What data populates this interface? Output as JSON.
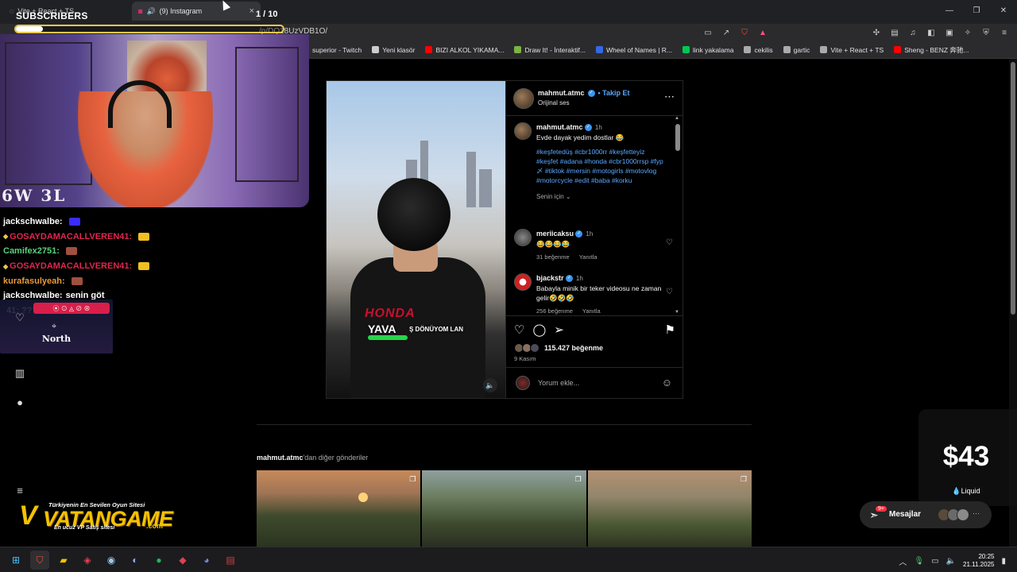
{
  "browser": {
    "inactive_tab_title": "Vite + React + TS",
    "active_tab_title": "(9) Instagram",
    "active_tab_audio": "🔊",
    "url": "/p/DQ18UzVDB1O/",
    "bookmarks": [
      {
        "label": "superior - Twitch",
        "color": "#9146ff"
      },
      {
        "label": "Yeni klasör",
        "color": "#cccccc"
      },
      {
        "label": "BIZI ALKOL YIKAMA...",
        "color": "#ff0000"
      },
      {
        "label": "Draw It! - İnteraktif...",
        "color": "#7cb342"
      },
      {
        "label": "Wheel of Names | R...",
        "color": "#3369e8"
      },
      {
        "label": "link yakalama",
        "color": "#00c853"
      },
      {
        "label": "cekilis",
        "color": "#aaaaaa"
      },
      {
        "label": "gartic",
        "color": "#aaaaaa"
      },
      {
        "label": "Vite + React + TS",
        "color": "#aaaaaa"
      },
      {
        "label": "Sheng - BENZ 奔驰...",
        "color": "#ff0000"
      }
    ]
  },
  "stream": {
    "subscribers_label": "SUBSCRIBERS",
    "sub_goal": "1 / 10",
    "sub_progress": 0.1,
    "record": "6W 3L",
    "chat": [
      {
        "user": "jackschwalbe:",
        "text": "",
        "user_color": "#ffffff",
        "emote": "#3a2cff"
      },
      {
        "user": "GOSAYDAMACALLVEREN41:",
        "text": "",
        "user_color": "#e0264f",
        "emote": "#f0c020",
        "badge": true
      },
      {
        "user": "Camifex2751:",
        "text": "",
        "user_color": "#5ad17a",
        "emote": "#a05040"
      },
      {
        "user": "GOSAYDAMACALLVEREN41:",
        "text": "",
        "user_color": "#e0264f",
        "emote": "#f0c020",
        "badge": true
      },
      {
        "user": "kurafasulyeah:",
        "text": "",
        "user_color": "#e89a3a",
        "emote": "#a05040"
      },
      {
        "user": "jackschwalbe:",
        "text": "senin göt",
        "user_color": "#ffffff",
        "emote": ""
      },
      {
        "user": "",
        "text": "41: ????",
        "user_color": "#e0264f",
        "emote": ""
      }
    ],
    "north_label": "North",
    "sponsor": {
      "tagline": "Türkiyenin En Sevilen Oyun Sitesi",
      "brand": "VATANGAME",
      "domain": ".com",
      "subtitle": "En ucuz VP Satış sitesi"
    },
    "price": "$43",
    "price_label": "💧Liquid"
  },
  "post": {
    "author": "mahmut.atmc",
    "follow": "• Takip Et",
    "audio": "Orijinal ses",
    "caption_time": "1h",
    "caption": "Evde dayak yedim dostlar 😂",
    "hashtags": "#keşfetedüş #cbr1000rr #keşfetteyiz #keşfet #adana #honda #cbr1000rrsp #fyp〆 #tiktok #mersin #motogirls #motovlog #motorcycle #edit #baba #korku",
    "for_you": "Senin için ⌄",
    "video_brand": "HONDA",
    "video_caption_big": "YAVA",
    "video_caption_small": "Ş DÖNÜYOM LAN",
    "comments": [
      {
        "user": "meriicaksu",
        "time": "1h",
        "text": "😂😂😂😂",
        "likes": "31 beğenme",
        "reply": "Yanıtla"
      },
      {
        "user": "bjackstr",
        "time": "1h",
        "text": "Babayla minik bir teker videosu ne zaman gelir🤣🤣🤣",
        "likes": "256 beğenme",
        "reply": "Yanıtla"
      }
    ],
    "likes": "115.427 beğenme",
    "date": "9 Kasım",
    "comment_placeholder": "Yorum ekle...",
    "more_posts_user": "mahmut.atmc",
    "more_posts_suffix": "'dan diğer gönderiler"
  },
  "messages": {
    "label": "Mesajlar",
    "badge": "9+"
  },
  "taskbar": {
    "time": "20:25",
    "date": "21.11.2025"
  }
}
